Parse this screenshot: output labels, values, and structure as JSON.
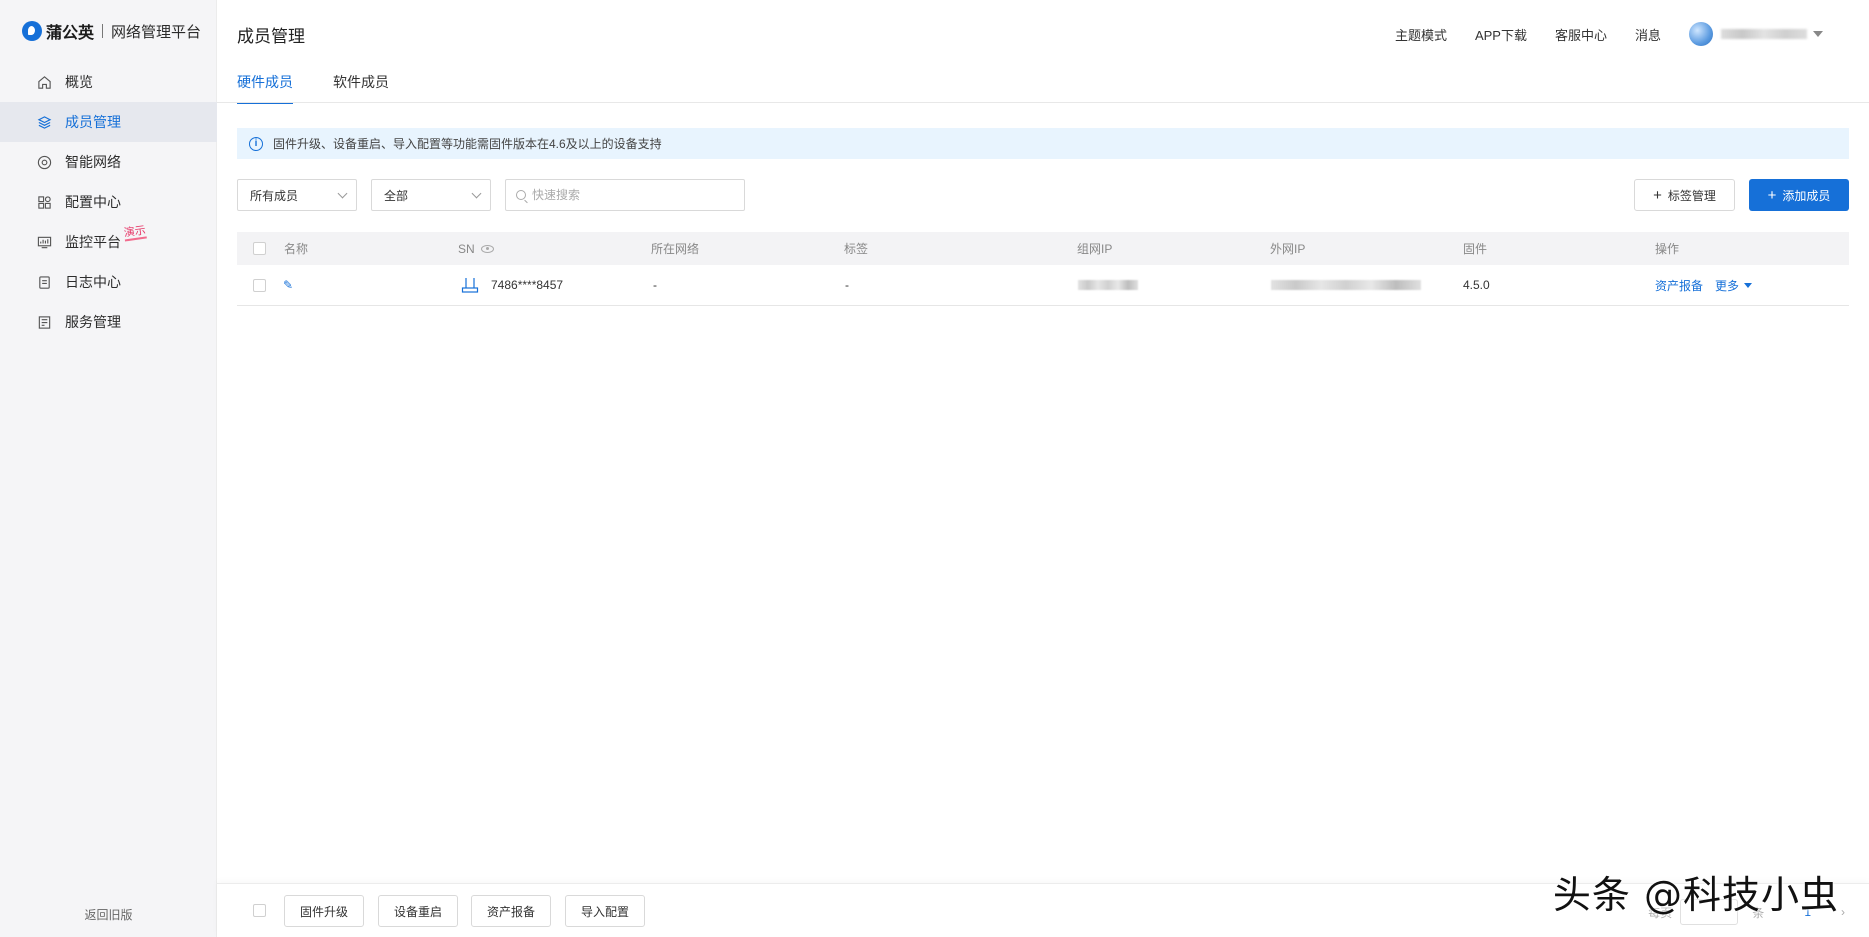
{
  "brand": {
    "name": "蒲公英",
    "subtitle": "网络管理平台"
  },
  "sidebar": {
    "items": [
      {
        "label": "概览",
        "icon": "home-icon"
      },
      {
        "label": "成员管理",
        "icon": "layers-icon",
        "active": true
      },
      {
        "label": "智能网络",
        "icon": "network-icon"
      },
      {
        "label": "配置中心",
        "icon": "grid-icon"
      },
      {
        "label": "监控平台",
        "icon": "monitor-icon",
        "badge": "演示"
      },
      {
        "label": "日志中心",
        "icon": "log-icon"
      },
      {
        "label": "服务管理",
        "icon": "service-icon"
      }
    ],
    "back_old": "返回旧版"
  },
  "header": {
    "title": "成员管理",
    "links": [
      "主题模式",
      "APP下载",
      "客服中心",
      "消息"
    ]
  },
  "tabs": [
    "硬件成员",
    "软件成员"
  ],
  "notice": "固件升级、设备重启、导入配置等功能需固件版本在4.6及以上的设备支持",
  "filters": {
    "member_select": "所有成员",
    "scope_select": "全部",
    "search_placeholder": "快速搜索",
    "tag_button": "标签管理",
    "add_button": "添加成员"
  },
  "table": {
    "columns": [
      "名称",
      "SN",
      "所在网络",
      "标签",
      "组网IP",
      "外网IP",
      "固件",
      "操作"
    ],
    "rows": [
      {
        "name": "",
        "sn": "7486****8457",
        "network": "-",
        "tag": "-",
        "firmware": "4.5.0",
        "action_report": "资产报备",
        "action_more": "更多"
      }
    ]
  },
  "footer": {
    "buttons": [
      "固件升级",
      "设备重启",
      "资产报备",
      "导入配置"
    ],
    "per_page": "每页",
    "total": "条",
    "page": "1"
  },
  "watermark": "头条 @科技小虫",
  "colors": {
    "accent": "#1670d8",
    "badge": "#e63a6a"
  }
}
